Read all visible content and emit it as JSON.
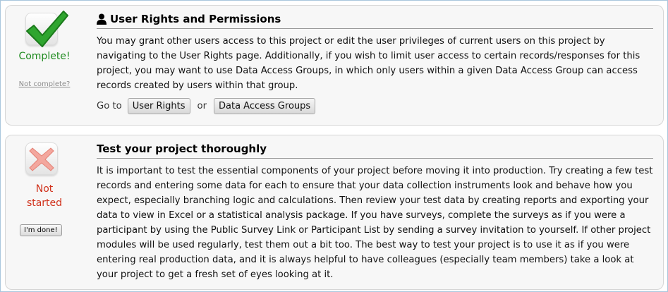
{
  "step_user_rights": {
    "icon": "checkmark-icon",
    "status": "Complete!",
    "not_complete_link": "Not complete?",
    "title_icon": "user-icon",
    "title": "User Rights and Permissions",
    "description": "You may grant other users access to this project or edit the user privileges of current users on this project by navigating to the User Rights page. Additionally, if you wish to limit user access to certain records/responses for this project, you may want to use Data Access Groups, in which only users within a given Data Access Group can access records created by users within that group.",
    "goto_label": "Go to",
    "user_rights_button": "User Rights",
    "or_label": "or",
    "dag_button": "Data Access Groups"
  },
  "step_testing": {
    "icon": "x-icon",
    "status_line1": "Not",
    "status_line2": "started",
    "done_button": "I'm done!",
    "title": "Test your project thoroughly",
    "description": "It is important to test the essential components of your project before moving it into production. Try creating a few test records and entering some data for each to ensure that your data collection instruments look and behave how you expect, especially branching logic and calculations. Then review your test data by creating reports and exporting your data to view in Excel or a statistical analysis package. If you have surveys, complete the surveys as if you were a participant by using the Public Survey Link or Participant List by sending a survey invitation to yourself. If other project modules will be used regularly, test them out a bit too. The best way to test your project is to use it as if you were entering real production data, and it is always helpful to have colleagues (especially team members) take a look at your project to get a fresh set of eyes looking at it."
  },
  "colors": {
    "complete_green": "#1e8a1e",
    "not_started_red": "#d0301a",
    "panel_bg": "#f7f7f7"
  }
}
